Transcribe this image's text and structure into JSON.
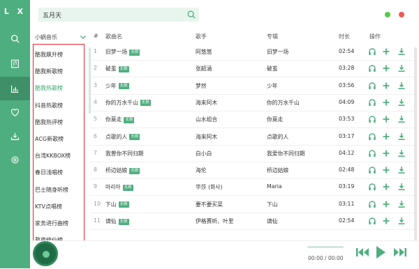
{
  "app": {
    "logo": "L X"
  },
  "search": {
    "value": "五月天"
  },
  "source": {
    "label": "小蜗音乐"
  },
  "boards": [
    "酷我飙升榜",
    "酷我新歌榜",
    "酷我热歌榜",
    "抖音热歌榜",
    "酷我热评榜",
    "ACG新歌榜",
    "台湾KKBOX榜",
    "春日浅唱榜",
    "巴士随身听榜",
    "KTV点唱榜",
    "家务进行曲榜",
    "熬夜修仙榜"
  ],
  "active_board_index": 2,
  "table": {
    "headers": {
      "num": "#",
      "title": "歌曲名",
      "artist": "歌手",
      "album": "专辑",
      "duration": "时长",
      "ops": "操作"
    },
    "badge": "无损",
    "rows": [
      {
        "n": "1",
        "title": "旧梦一场",
        "badge": true,
        "artist": "阿悠悠",
        "album": "旧梦一场",
        "time": "02:54"
      },
      {
        "n": "2",
        "title": "破茧",
        "badge": true,
        "artist": "张韶涵",
        "album": "破茧",
        "time": "03:28"
      },
      {
        "n": "3",
        "title": "少年",
        "badge": true,
        "artist": "梦然",
        "album": "少年",
        "time": "03:56"
      },
      {
        "n": "4",
        "title": "你的万水千山",
        "badge": true,
        "artist": "海来阿木",
        "album": "你的万水千山",
        "time": "04:09"
      },
      {
        "n": "5",
        "title": "你莫走",
        "badge": true,
        "artist": "山水组合",
        "album": "你莫走",
        "time": "03:53"
      },
      {
        "n": "6",
        "title": "点歌的人",
        "badge": true,
        "artist": "海来阿木",
        "album": "点歌的人",
        "time": "03:17"
      },
      {
        "n": "7",
        "title": "我曾你不同归期",
        "badge": false,
        "artist": "白小白",
        "album": "我爱你不同归期",
        "time": "04:12"
      },
      {
        "n": "8",
        "title": "桥边姑娘",
        "badge": true,
        "artist": "海伦",
        "album": "桥边姑娘",
        "time": "02:48"
      },
      {
        "n": "9",
        "title": "마리아",
        "badge": true,
        "artist": "华莎 (화사)",
        "album": "Maria",
        "time": "03:19"
      },
      {
        "n": "10",
        "title": "下山",
        "badge": true,
        "artist": "要不要买菜",
        "album": "下山",
        "time": "03:11"
      },
      {
        "n": "11",
        "title": "谪仙",
        "badge": true,
        "artist": "伊格赛听、叶里",
        "album": "谪仙",
        "time": "02:54"
      }
    ]
  },
  "player": {
    "time": "00:00 / 00:00",
    "progress": 1.0
  },
  "colors": {
    "accent": "#4fae7f",
    "highlight_frame": "#e0242d"
  }
}
